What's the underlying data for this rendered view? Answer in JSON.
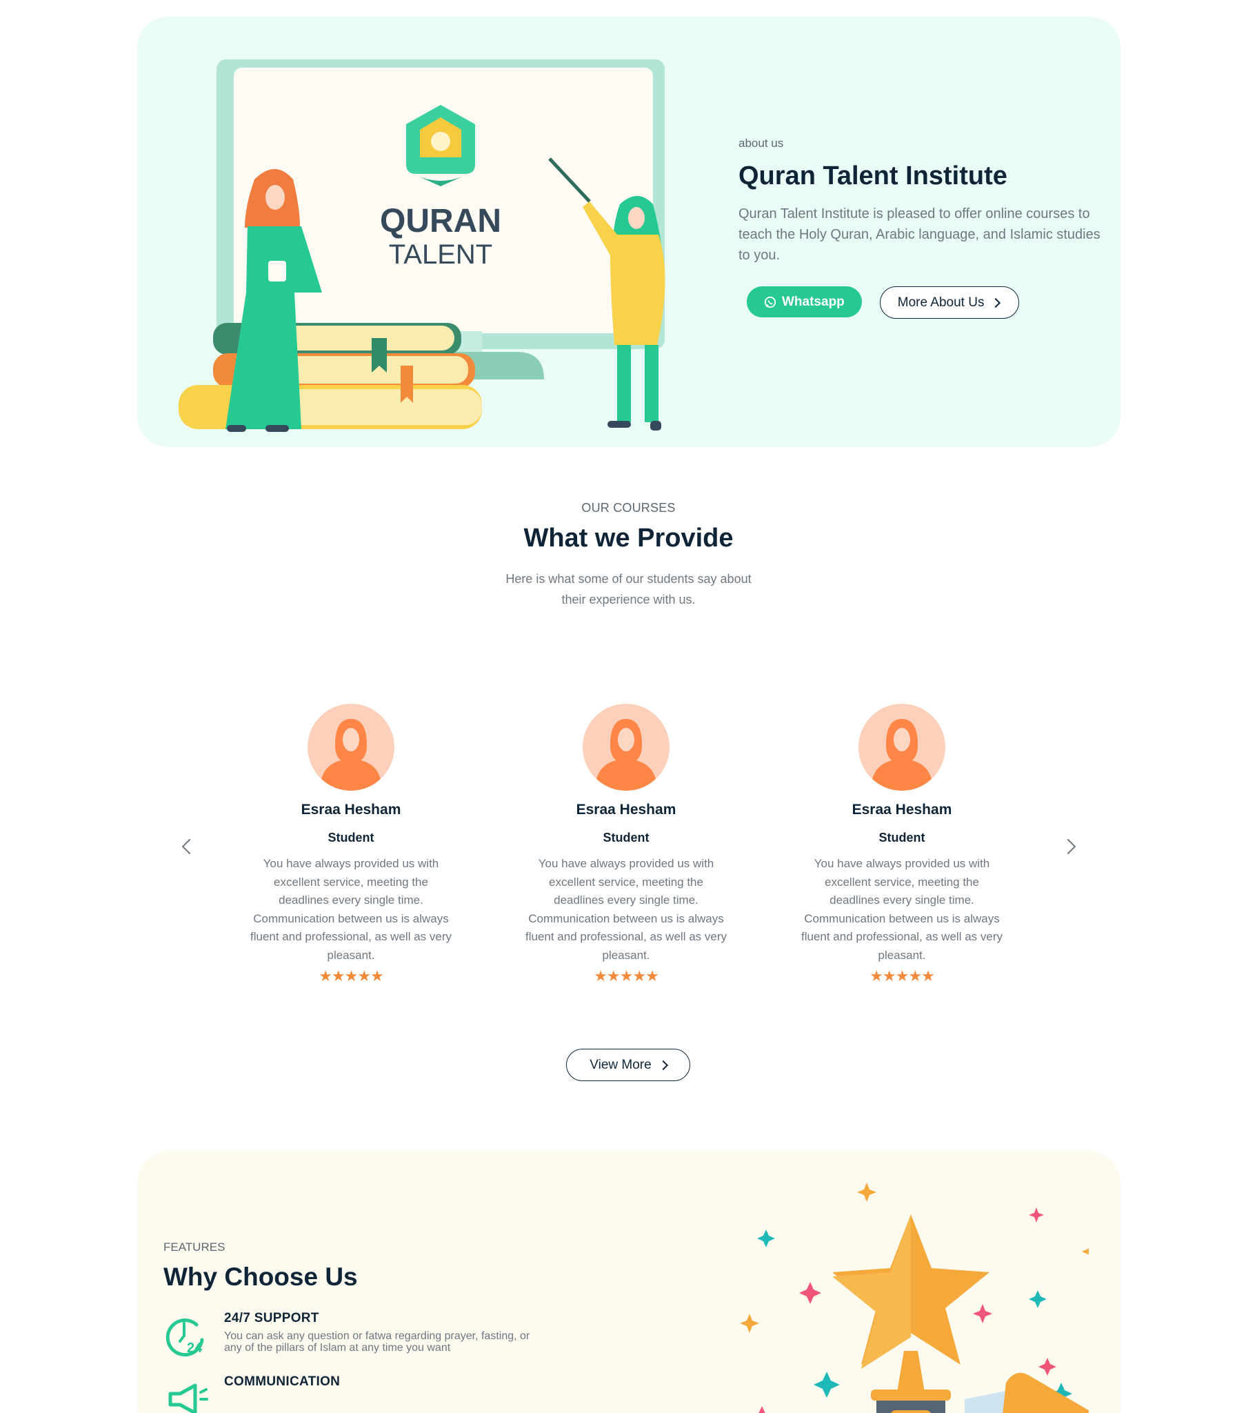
{
  "about": {
    "eyebrow": "about us",
    "title": "Quran Talent Institute",
    "description": "Quran Talent Institute is pleased to offer online courses to teach the Holy Quran, Arabic language, and Islamic studies to you.",
    "whatsapp_label": "Whatsapp",
    "more_label": "More About Us",
    "logo_line1": "QURAN",
    "logo_line2": "TALENT"
  },
  "courses": {
    "eyebrow": "OUR COURSES",
    "title": "What we Provide",
    "subtitle": "Here is what some of our students say about their experience with us.",
    "view_more_label": "View More",
    "testimonials": [
      {
        "name": "Esraa Hesham",
        "role": "Student",
        "text": "You have always provided us with excellent service, meeting the deadlines every single time. Communication between us is always fluent and professional, as well as very pleasant.",
        "stars": "★★★★★",
        "rating": 5
      },
      {
        "name": "Esraa Hesham",
        "role": "Student",
        "text": "You have always provided us with excellent service, meeting the deadlines every single time. Communication between us is always fluent and professional, as well as very pleasant.",
        "stars": "★★★★★",
        "rating": 5
      },
      {
        "name": "Esraa Hesham",
        "role": "Student",
        "text": "You have always provided us with excellent service, meeting the deadlines every single time. Communication between us is always fluent and professional, as well as very pleasant.",
        "stars": "★★★★★",
        "rating": 5
      }
    ]
  },
  "features": {
    "eyebrow": "FEATURES",
    "title": "Why Choose Us",
    "items": [
      {
        "title": "24/7 SUPPORT",
        "description": "You can ask any question or fatwa regarding prayer, fasting, or any of the pillars of Islam at any time you want",
        "icon": "clock-24-icon"
      },
      {
        "title": "COMMUNICATION",
        "description": "",
        "icon": "megaphone-icon"
      }
    ]
  },
  "colors": {
    "accent": "#27c993",
    "heading": "#0f2537",
    "star": "#f28a3c",
    "about_bg": "#e9fcf6",
    "features_bg": "#fdfaef"
  }
}
